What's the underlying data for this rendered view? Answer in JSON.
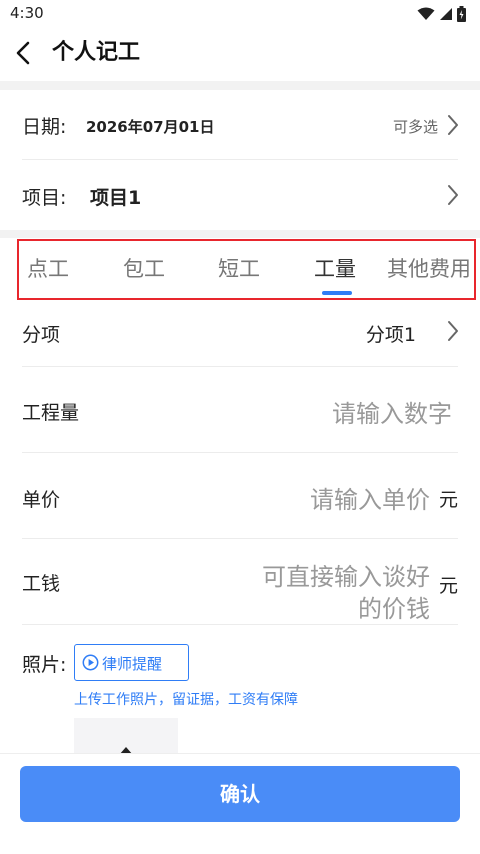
{
  "status_bar": {
    "time": "4:30",
    "icons": [
      "wifi-icon",
      "signal-icon",
      "battery-icon"
    ]
  },
  "header": {
    "title": "个人记工",
    "back_icon": "back-arrow-icon"
  },
  "date_row": {
    "label": "日期:",
    "value": "2026年07月01日",
    "hint": "可多选"
  },
  "project_row": {
    "label": "项目:",
    "value": "项目1"
  },
  "tabs": [
    {
      "label": "点工"
    },
    {
      "label": "包工"
    },
    {
      "label": "短工"
    },
    {
      "label": "工量",
      "active": true
    },
    {
      "label": "其他费用"
    }
  ],
  "form": {
    "subitem": {
      "label": "分项",
      "value": "分项1"
    },
    "quantity": {
      "label": "工程量",
      "placeholder": "请输入数字"
    },
    "unit_price": {
      "label": "单价",
      "placeholder": "请输入单价",
      "unit": "元"
    },
    "wage": {
      "label": "工钱",
      "placeholder_line1": "可直接输入谈好",
      "placeholder_line2": "的价钱",
      "unit": "元"
    }
  },
  "photos": {
    "label": "照片:",
    "lawyer_button": "律师提醒",
    "note": "上传工作照片，留证据，工资有保障",
    "upload_icon": "upload-arrow-icon"
  },
  "confirm_button": "确认",
  "colors": {
    "accent": "#2f7df6",
    "confirm_bg": "#4a8cf7",
    "highlight_border": "#e8262d"
  }
}
